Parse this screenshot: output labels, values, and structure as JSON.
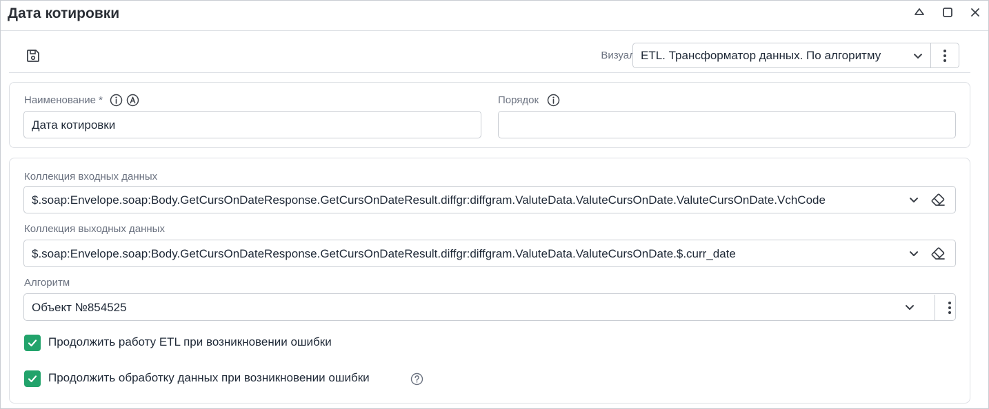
{
  "window": {
    "title": "Дата котировки"
  },
  "toolbar": {
    "visual_label": "Визуал:",
    "visual_value": "ETL. Трансформатор данных. По алгоритму"
  },
  "fields": {
    "name_label": "Наименование *",
    "name_value": "Дата котировки",
    "order_label": "Порядок",
    "order_value": "",
    "input_collection_label": "Коллекция входных данных",
    "input_collection_value": "$.soap:Envelope.soap:Body.GetCursOnDateResponse.GetCursOnDateResult.diffgr:diffgram.ValuteData.ValuteCursOnDate.ValuteCursOnDate.VchCode",
    "output_collection_label": "Коллекция выходных данных",
    "output_collection_value": "$.soap:Envelope.soap:Body.GetCursOnDateResponse.GetCursOnDateResult.diffgr:diffgram.ValuteData.ValuteCursOnDate.$.curr_date",
    "algorithm_label": "Алгоритм",
    "algorithm_value": "Объект №854525"
  },
  "checkboxes": [
    {
      "label": "Продолжить работу ETL при возникновении ошибки",
      "checked": true
    },
    {
      "label": "Продолжить обработку данных при возникновении ошибки",
      "checked": true
    }
  ],
  "colors": {
    "accent": "#22a36b",
    "border": "#c9cdd3",
    "label": "#6b7280",
    "text": "#1f2937"
  },
  "icons": {
    "minimize": "eject-icon",
    "maximize": "square-icon",
    "close": "close-icon",
    "save": "floppy-disk-icon",
    "dropdown": "chevron-down-icon",
    "menu": "vertical-dots-icon",
    "clear": "eraser-icon",
    "info": "info-icon",
    "auto": "letter-a-icon",
    "help": "question-icon",
    "check": "check-icon"
  }
}
